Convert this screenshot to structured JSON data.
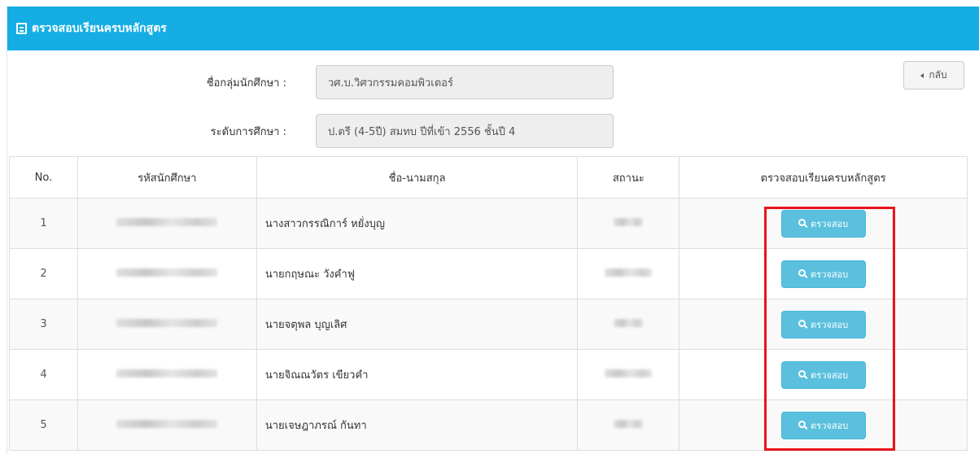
{
  "panel": {
    "title": "ตรวจสอบเรียนครบหลักสูตร",
    "accent": "#16ade4"
  },
  "form": {
    "group_label": "ชื่อกลุ่มนักศึกษา :",
    "group_value": "วศ.บ.วิศวกรรมคอมพิวเตอร์",
    "level_label": "ระดับการศึกษา :",
    "level_value": "ป.ตรี (4-5ปี) สมทบ ปีที่เข้า 2556 ชั้นปี 4"
  },
  "back_button": {
    "label": "กลับ",
    "icon": "caret-left-icon"
  },
  "table": {
    "headers": [
      "No.",
      "รหัสนักศึกษา",
      "ชื่อ-นามสกุล",
      "สถานะ",
      "ตรวจสอบเรียนครบหลักสูตร"
    ],
    "check_label": "ตรวจสอบ",
    "check_icon": "search-icon",
    "button_color": "#5bc0de",
    "rows": [
      {
        "no": "1",
        "name": "นางสาวกรรณิการ์ หยั่งบุญ"
      },
      {
        "no": "2",
        "name": "นายกฤษณะ วังคำฟู"
      },
      {
        "no": "3",
        "name": "นายจตุพล บุญเลิศ"
      },
      {
        "no": "4",
        "name": "นายจิณณวัตร เขียวคำ"
      },
      {
        "no": "5",
        "name": "นายเจษฎาภรณ์ กันทา"
      }
    ]
  },
  "highlight_color": "#e8141a"
}
